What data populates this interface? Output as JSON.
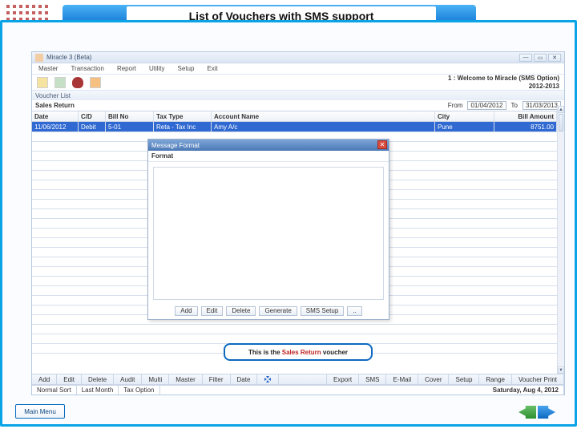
{
  "slide": {
    "title": "List of Vouchers with SMS support"
  },
  "window": {
    "title": "Miracle 3 (Beta)",
    "welcome_line1": "1 : Welcome to Miracle (SMS Option)",
    "welcome_line2": "2012-2013"
  },
  "menu": [
    "Master",
    "Transaction",
    "Report",
    "Utility",
    "Setup",
    "Exit"
  ],
  "voucher_list_label": "Voucher List",
  "heading": "Sales Return",
  "date_range": {
    "from_label": "From",
    "from": "01/04/2012",
    "to_label": "To",
    "to": "31/03/2013"
  },
  "grid": {
    "columns": [
      "Date",
      "C/D",
      "Bill No",
      "Tax Type",
      "Account Name",
      "City",
      "Bill Amount"
    ],
    "rows": [
      {
        "date": "11/06/2012",
        "cd": "Debit",
        "billno": "5-01",
        "taxtype": "Reta - Tax Inc",
        "acc": "Amy A/c",
        "city": "Pune",
        "amt": "8751.00"
      }
    ]
  },
  "modal": {
    "title": "Message Format",
    "label": "Format",
    "buttons": [
      "Add",
      "Edit",
      "Delete",
      "Generate",
      "SMS Setup",
      ".."
    ]
  },
  "callout": {
    "pre": "This is the ",
    "highlight": "Sales Return",
    "post": " voucher"
  },
  "footer_buttons_left": [
    "Add",
    "Edit",
    "Delete",
    "Audit",
    "Multi",
    "Master",
    "Filter",
    "Date"
  ],
  "footer_buttons_right": [
    "Export",
    "SMS",
    "E-Mail",
    "Cover",
    "Setup",
    "Range",
    "Voucher Print"
  ],
  "status": {
    "left": [
      "Normal Sort",
      "Last Month",
      "Tax Option"
    ],
    "date": "Saturday, Aug 4, 2012"
  },
  "main_menu_button": "Main Menu"
}
